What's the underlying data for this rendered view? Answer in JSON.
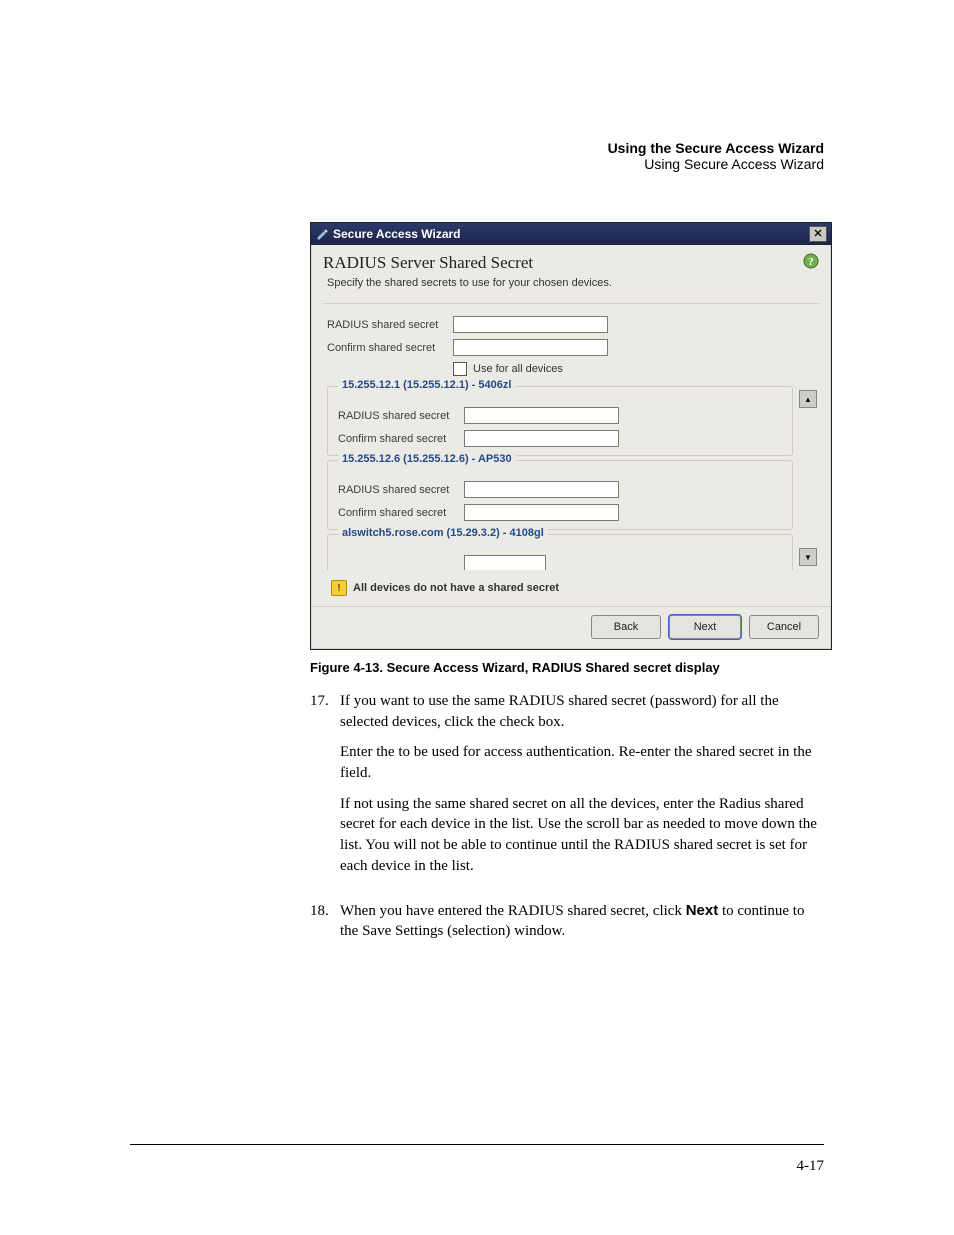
{
  "header": {
    "title": "Using the Secure Access Wizard",
    "subtitle": "Using Secure Access Wizard"
  },
  "dialog": {
    "title": "Secure Access Wizard",
    "heading": "RADIUS Server Shared Secret",
    "subheading": "Specify the shared secrets to use for your chosen devices.",
    "global": {
      "radius_label": "RADIUS shared secret",
      "confirm_label": "Confirm shared secret",
      "use_all_label": "Use for all devices"
    },
    "devices": [
      {
        "legend": "15.255.12.1 (15.255.12.1) - 5406zl",
        "radius_label": "RADIUS shared secret",
        "confirm_label": "Confirm shared secret"
      },
      {
        "legend": "15.255.12.6 (15.255.12.6) - AP530",
        "radius_label": "RADIUS shared secret",
        "confirm_label": "Confirm shared secret"
      },
      {
        "legend": "alswitch5.rose.com (15.29.3.2) - 4108gl"
      }
    ],
    "warning": "All devices do not have a shared secret",
    "buttons": {
      "back": "Back",
      "next": "Next",
      "cancel": "Cancel"
    }
  },
  "figure_caption": "Figure 4-13. Secure Access Wizard, RADIUS Shared secret display",
  "steps": {
    "s17_num": "17.",
    "s17_p1a": "If you want to use the same RADIUS shared secret (password) for all the selected devices, click the ",
    "s17_p1b": " check box.",
    "s17_p2a": "Enter the ",
    "s17_p2b": " to be used for access authentication. Re-enter the shared secret in the ",
    "s17_p2c": " field.",
    "s17_p3": "If not using the same shared secret on all the devices, enter the Radius shared secret for each device in the list. Use the scroll bar as needed to move down the list. You will not be able to continue until the RADIUS shared secret is set for each device in the list.",
    "s18_num": "18.",
    "s18_p1a": "When you have entered the RADIUS shared secret, click ",
    "s18_p1b": "Next",
    "s18_p1c": " to continue to the Save Settings (selection) window."
  },
  "page_number": "4-17"
}
